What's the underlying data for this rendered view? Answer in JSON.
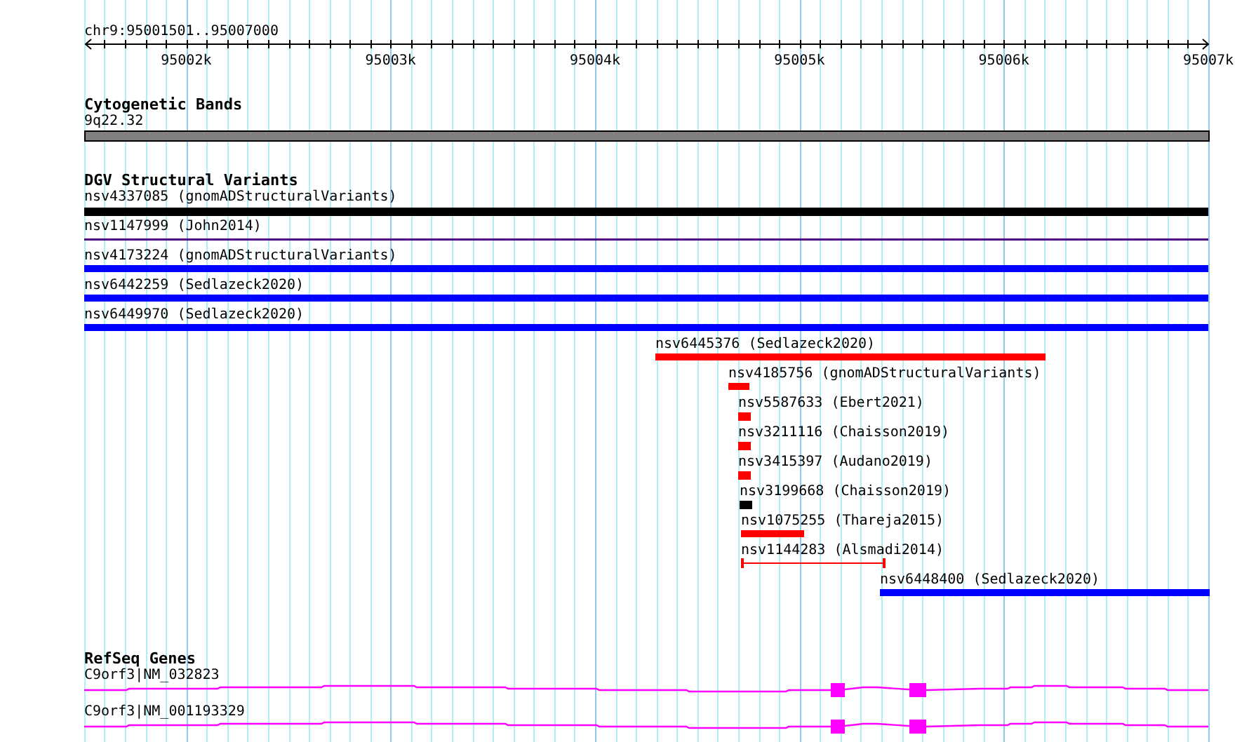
{
  "ruler": {
    "region": "chr9:95001501..95007000",
    "ticks": [
      "95002k",
      "95003k",
      "95004k",
      "95005k",
      "95006k",
      "95007k"
    ]
  },
  "tracks": [
    {
      "title": "Cytogenetic Bands",
      "features": [
        {
          "label": "9q22.32",
          "kind": "band",
          "color": "#808080"
        }
      ]
    },
    {
      "title": "DGV Structural Variants",
      "features": [
        {
          "label": "nsv4337085 (gnomADStructuralVariants)",
          "kind": "bar",
          "color": "#000000"
        },
        {
          "label": "nsv1147999 (John2014)",
          "kind": "line",
          "color": "#4b0082"
        },
        {
          "label": "nsv4173224 (gnomADStructuralVariants)",
          "kind": "bar",
          "color": "#0000ff"
        },
        {
          "label": "nsv6442259 (Sedlazeck2020)",
          "kind": "bar",
          "color": "#0000ff"
        },
        {
          "label": "nsv6449970 (Sedlazeck2020)",
          "kind": "bar",
          "color": "#0000ff"
        },
        {
          "label": "nsv6445376 (Sedlazeck2020)",
          "kind": "bar",
          "color": "#ff0000"
        },
        {
          "label": "nsv4185756 (gnomADStructuralVariants)",
          "kind": "bar",
          "color": "#ff0000"
        },
        {
          "label": "nsv5587633 (Ebert2021)",
          "kind": "bar",
          "color": "#ff0000"
        },
        {
          "label": "nsv3211116 (Chaisson2019)",
          "kind": "bar",
          "color": "#ff0000"
        },
        {
          "label": "nsv3415397 (Audano2019)",
          "kind": "bar",
          "color": "#ff0000"
        },
        {
          "label": "nsv3199668 (Chaisson2019)",
          "kind": "bar",
          "color": "#000000"
        },
        {
          "label": "nsv1075255 (Thareja2015)",
          "kind": "bar",
          "color": "#ff0000"
        },
        {
          "label": "nsv1144283 (Alsmadi2014)",
          "kind": "range",
          "color": "#ff0000"
        },
        {
          "label": "nsv6448400 (Sedlazeck2020)",
          "kind": "bar",
          "color": "#0000ff"
        }
      ]
    },
    {
      "title": "RefSeq Genes",
      "features": [
        {
          "label": "C9orf3|NM_032823",
          "kind": "gene",
          "color": "#ff00ff"
        },
        {
          "label": "C9orf3|NM_001193329",
          "kind": "gene",
          "color": "#ff00ff"
        }
      ]
    }
  ]
}
